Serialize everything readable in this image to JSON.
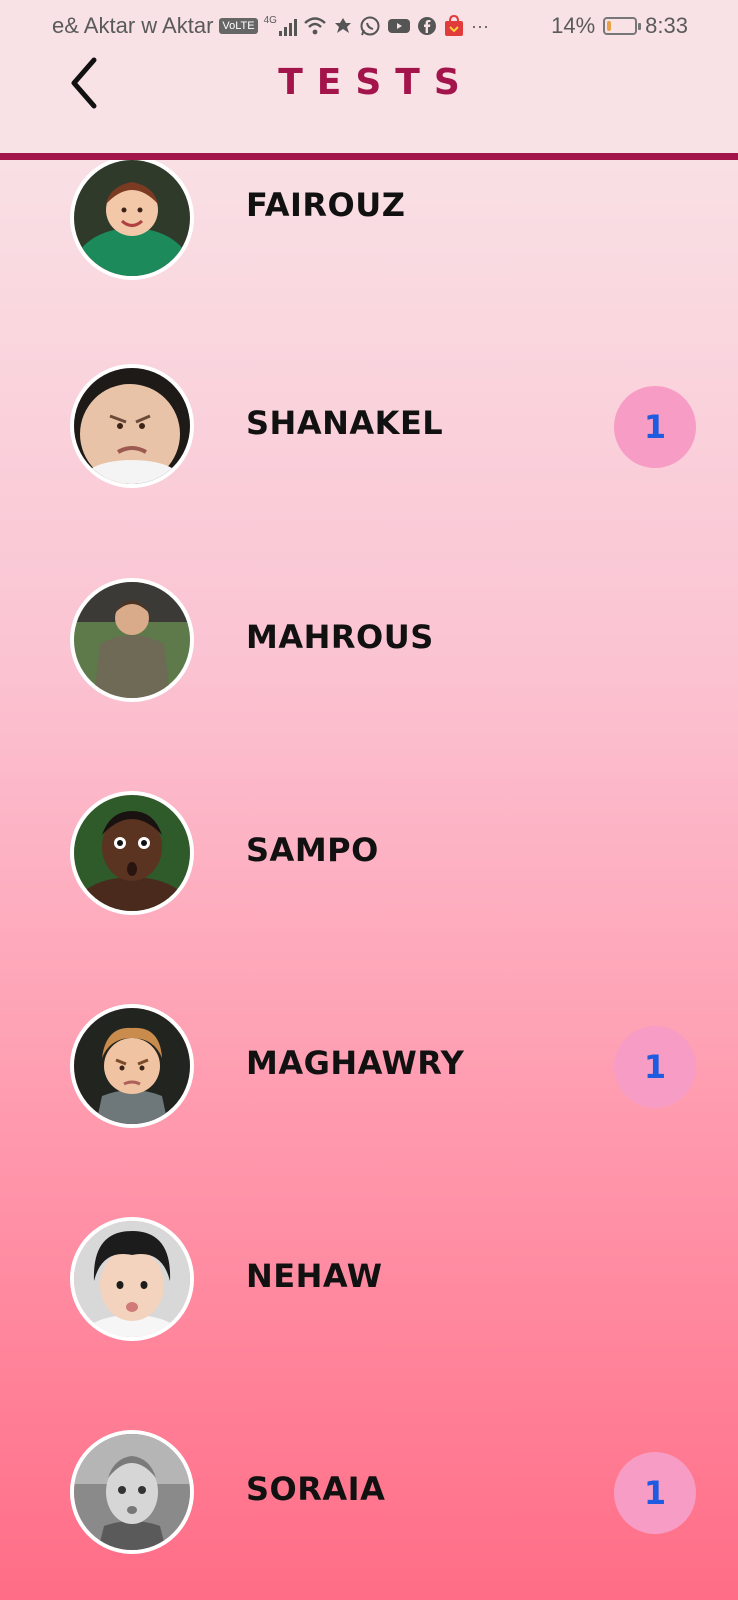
{
  "status_bar": {
    "carrier": "e& Aktar w Aktar",
    "network_badge": "VoLTE",
    "signal_label": "4G",
    "more": "···",
    "battery_percent": "14%",
    "battery_level": 0.14,
    "time": "8:33",
    "icons": [
      "volte-icon",
      "signal-icon",
      "wifi-icon",
      "leaf-icon",
      "whatsapp-icon",
      "youtube-icon",
      "facebook-icon",
      "shop-icon",
      "battery-icon"
    ]
  },
  "header": {
    "title": "TESTS",
    "back_icon": "chevron-left-icon"
  },
  "colors": {
    "accent": "#a3154a",
    "badge_bg": "#f79cc4",
    "badge_text": "#1f5be0"
  },
  "items": [
    {
      "name": "FAIROUZ",
      "badge": ""
    },
    {
      "name": "SHANAKEL",
      "badge": "1"
    },
    {
      "name": "MAHROUS",
      "badge": ""
    },
    {
      "name": "SAMPO",
      "badge": ""
    },
    {
      "name": "MAGHAWRY",
      "badge": "1"
    },
    {
      "name": "NEHAW",
      "badge": ""
    },
    {
      "name": "SORAIA",
      "badge": "1"
    }
  ]
}
